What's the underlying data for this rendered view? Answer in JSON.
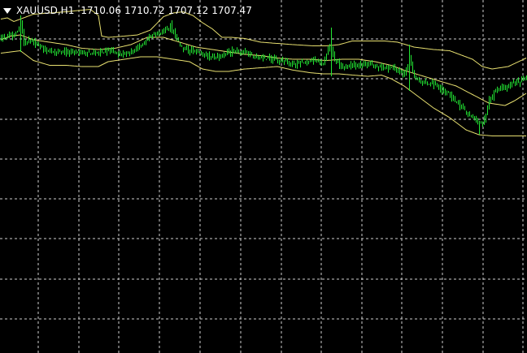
{
  "chart_header": {
    "symbol": "XAUUSD,H1",
    "open": "1710.06",
    "high": "1710.72",
    "low": "1707.12",
    "close": "1707.47"
  },
  "colors": {
    "background": "#000000",
    "grid": "#cfcfcf",
    "candle": "#22e633",
    "bands": "#e8e070",
    "text": "#ffffff"
  },
  "chart_data": {
    "type": "line",
    "title": "XAUUSD,H1",
    "grid": true,
    "grid_style": "dashed",
    "x_axis": "bar index (H1 candles, oldest to newest)",
    "ylim": [
      1580,
      1740
    ],
    "series": [
      {
        "kind": "candlestick",
        "close_anchors": [
          [
            0,
            1711
          ],
          [
            4,
            1713
          ],
          [
            7,
            1714
          ],
          [
            10,
            1717
          ],
          [
            12,
            1724
          ],
          [
            14,
            1708
          ],
          [
            18,
            1709
          ],
          [
            22,
            1705
          ],
          [
            26,
            1703
          ],
          [
            32,
            1700
          ],
          [
            38,
            1700
          ],
          [
            44,
            1700
          ],
          [
            50,
            1700
          ],
          [
            56,
            1699
          ],
          [
            62,
            1700
          ],
          [
            68,
            1702
          ],
          [
            74,
            1698
          ],
          [
            80,
            1700
          ],
          [
            86,
            1705
          ],
          [
            92,
            1713
          ],
          [
            98,
            1716
          ],
          [
            104,
            1720
          ],
          [
            108,
            1711
          ],
          [
            112,
            1702
          ],
          [
            116,
            1701
          ],
          [
            120,
            1700
          ],
          [
            126,
            1697
          ],
          [
            132,
            1696
          ],
          [
            138,
            1699
          ],
          [
            144,
            1701
          ],
          [
            150,
            1700
          ],
          [
            156,
            1696
          ],
          [
            162,
            1695
          ],
          [
            168,
            1694
          ],
          [
            174,
            1692
          ],
          [
            180,
            1690
          ],
          [
            186,
            1691
          ],
          [
            192,
            1693
          ],
          [
            198,
            1690
          ],
          [
            202,
            1705
          ],
          [
            205,
            1693
          ],
          [
            208,
            1690
          ],
          [
            212,
            1688
          ],
          [
            218,
            1689
          ],
          [
            224,
            1690
          ],
          [
            230,
            1688
          ],
          [
            236,
            1687
          ],
          [
            242,
            1686
          ],
          [
            248,
            1682
          ],
          [
            251,
            1695
          ],
          [
            254,
            1680
          ],
          [
            258,
            1676
          ],
          [
            262,
            1675
          ],
          [
            268,
            1672
          ],
          [
            272,
            1668
          ],
          [
            276,
            1665
          ],
          [
            280,
            1658
          ],
          [
            284,
            1654
          ],
          [
            288,
            1648
          ],
          [
            292,
            1644
          ],
          [
            296,
            1640
          ],
          [
            300,
            1660
          ],
          [
            304,
            1668
          ],
          [
            308,
            1670
          ],
          [
            312,
            1672
          ],
          [
            316,
            1674
          ],
          [
            320,
            1677
          ],
          [
            323,
            1680
          ]
        ],
        "spikes": [
          {
            "at": 12,
            "high": 1730,
            "low": 1700
          },
          {
            "at": 105,
            "high": 1726
          },
          {
            "at": 203,
            "high": 1720,
            "low": 1680
          },
          {
            "at": 251,
            "high": 1706,
            "low": 1668
          },
          {
            "at": 294,
            "low": 1632
          }
        ]
      },
      {
        "kind": "upper-band",
        "values": [
          [
            0,
            1727
          ],
          [
            4,
            1728
          ],
          [
            8,
            1725
          ],
          [
            14,
            1728
          ],
          [
            20,
            1731
          ],
          [
            30,
            1732
          ],
          [
            40,
            1733
          ],
          [
            55,
            1735
          ],
          [
            60,
            1730
          ],
          [
            62,
            1713
          ],
          [
            66,
            1712
          ],
          [
            76,
            1713
          ],
          [
            84,
            1714
          ],
          [
            92,
            1718
          ],
          [
            100,
            1729
          ],
          [
            106,
            1732
          ],
          [
            112,
            1733
          ],
          [
            118,
            1730
          ],
          [
            124,
            1724
          ],
          [
            130,
            1719
          ],
          [
            136,
            1712
          ],
          [
            142,
            1712
          ],
          [
            150,
            1711
          ],
          [
            160,
            1708
          ],
          [
            170,
            1707
          ],
          [
            180,
            1706
          ],
          [
            192,
            1705
          ],
          [
            200,
            1705
          ],
          [
            208,
            1706
          ],
          [
            216,
            1709
          ],
          [
            226,
            1709
          ],
          [
            236,
            1709
          ],
          [
            244,
            1708
          ],
          [
            254,
            1704
          ],
          [
            266,
            1702
          ],
          [
            276,
            1701
          ],
          [
            290,
            1694
          ],
          [
            296,
            1688
          ],
          [
            302,
            1686
          ],
          [
            312,
            1688
          ],
          [
            323,
            1695
          ]
        ]
      },
      {
        "kind": "middle-band",
        "values": [
          [
            0,
            1710
          ],
          [
            6,
            1713
          ],
          [
            12,
            1714
          ],
          [
            20,
            1710
          ],
          [
            30,
            1708
          ],
          [
            40,
            1706
          ],
          [
            50,
            1703
          ],
          [
            60,
            1702
          ],
          [
            70,
            1703
          ],
          [
            80,
            1706
          ],
          [
            90,
            1712
          ],
          [
            100,
            1712
          ],
          [
            110,
            1708
          ],
          [
            120,
            1704
          ],
          [
            130,
            1702
          ],
          [
            140,
            1700
          ],
          [
            150,
            1698
          ],
          [
            160,
            1697
          ],
          [
            170,
            1695
          ],
          [
            180,
            1694
          ],
          [
            190,
            1694
          ],
          [
            200,
            1693
          ],
          [
            210,
            1694
          ],
          [
            220,
            1694
          ],
          [
            230,
            1692
          ],
          [
            240,
            1689
          ],
          [
            250,
            1684
          ],
          [
            260,
            1680
          ],
          [
            270,
            1676
          ],
          [
            280,
            1672
          ],
          [
            290,
            1665
          ],
          [
            300,
            1658
          ],
          [
            310,
            1656
          ],
          [
            316,
            1660
          ],
          [
            323,
            1666
          ]
        ]
      },
      {
        "kind": "lower-band",
        "values": [
          [
            0,
            1699
          ],
          [
            6,
            1700
          ],
          [
            12,
            1701
          ],
          [
            20,
            1693
          ],
          [
            30,
            1689
          ],
          [
            40,
            1689
          ],
          [
            50,
            1688
          ],
          [
            60,
            1688
          ],
          [
            66,
            1692
          ],
          [
            76,
            1694
          ],
          [
            86,
            1696
          ],
          [
            96,
            1696
          ],
          [
            106,
            1694
          ],
          [
            116,
            1692
          ],
          [
            124,
            1686
          ],
          [
            132,
            1684
          ],
          [
            140,
            1684
          ],
          [
            150,
            1686
          ],
          [
            160,
            1687
          ],
          [
            170,
            1688
          ],
          [
            180,
            1685
          ],
          [
            190,
            1683
          ],
          [
            198,
            1682
          ],
          [
            208,
            1682
          ],
          [
            216,
            1681
          ],
          [
            226,
            1680
          ],
          [
            234,
            1681
          ],
          [
            240,
            1678
          ],
          [
            248,
            1672
          ],
          [
            256,
            1664
          ],
          [
            266,
            1654
          ],
          [
            276,
            1646
          ],
          [
            286,
            1636
          ],
          [
            294,
            1632
          ],
          [
            302,
            1631
          ],
          [
            312,
            1631
          ],
          [
            323,
            1631
          ]
        ]
      }
    ]
  }
}
